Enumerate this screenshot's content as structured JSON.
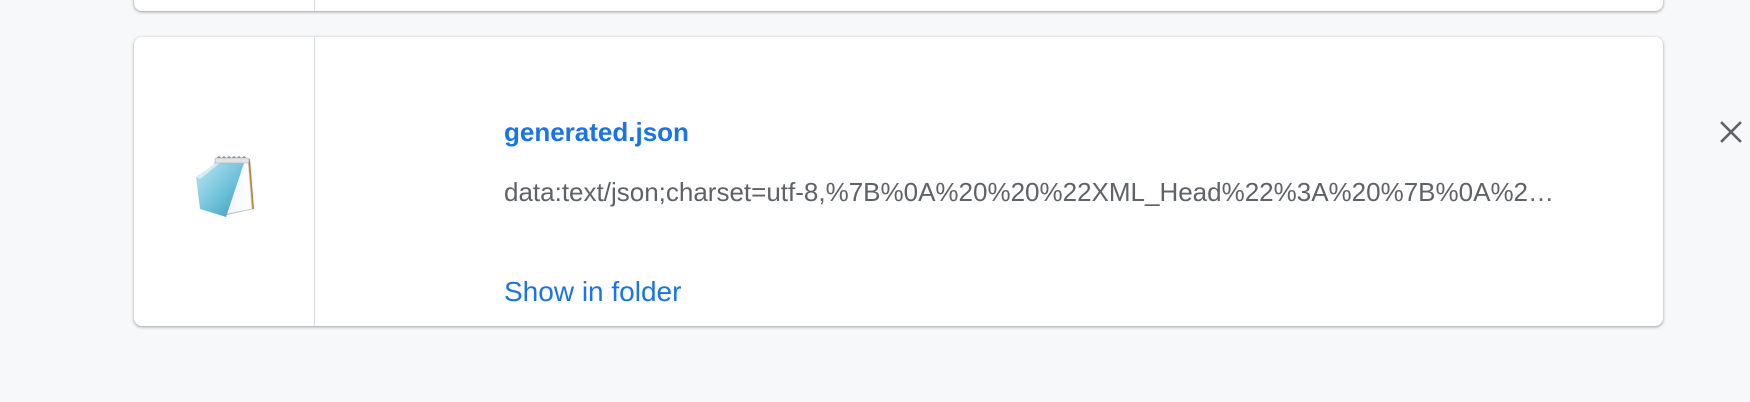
{
  "download_item": {
    "file_name": "generated.json",
    "url": "data:text/json;charset=utf-8,%7B%0A%20%20%22XML_Head%22%3A%20%7B%0A%2…",
    "show_in_folder_label": "Show in folder",
    "file_icon": "notepad-icon",
    "close_icon": "close-icon"
  },
  "colors": {
    "link": "#1a73e8",
    "secondary_text": "#5f6368",
    "background": "#f7f8fa",
    "card": "#ffffff",
    "divider": "#dadce0"
  }
}
